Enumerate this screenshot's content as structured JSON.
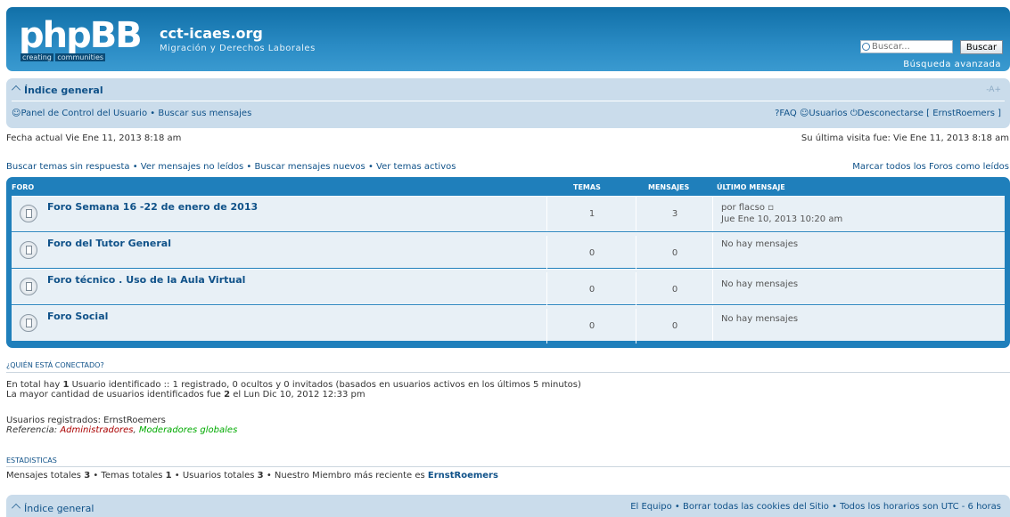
{
  "header": {
    "logo_text": "phpBB",
    "logo_tagline_a": "creating",
    "logo_tagline_b": "communities",
    "site_title": "cct-icaes.org",
    "site_description": "Migración y Derechos Laborales",
    "search_placeholder": "Buscar...",
    "search_button": "Buscar",
    "advanced_search": "Búsqueda avanzada"
  },
  "navbar": {
    "breadcrumb": "Índice general",
    "font_size_control": "-A+",
    "ucp": "Panel de Control del Usuario",
    "own_posts": "Buscar sus mensajes",
    "faq": "FAQ",
    "members": "Usuarios",
    "logout": "Desconectarse [ ErnstRoemers ]"
  },
  "dates": {
    "current": "Fecha actual Vie Ene 11, 2013 8:18 am",
    "last_visit": "Su última visita fue: Vie Ene 11, 2013 8:18 am"
  },
  "quick_links": {
    "unanswered": "Buscar temas sin respuesta",
    "unread": "Ver mensajes no leídos",
    "new_posts": "Buscar mensajes nuevos",
    "active": "Ver temas activos",
    "mark_read": "Marcar todos los Foros como leídos"
  },
  "forum_table": {
    "col_forum": "FORO",
    "col_topics": "TEMAS",
    "col_posts": "MENSAJES",
    "col_last": "ÚLTIMO MENSAJE",
    "rows": [
      {
        "title": "Foro Semana 16 -22 de enero de 2013",
        "topics": "1",
        "posts": "3",
        "last_line1": "por flacso",
        "last_line2": "Jue Ene 10, 2013 10:20 am"
      },
      {
        "title": "Foro del Tutor General",
        "topics": "0",
        "posts": "0",
        "last_line1": "No hay mensajes",
        "last_line2": ""
      },
      {
        "title": "Foro técnico . Uso de la Aula Virtual",
        "topics": "0",
        "posts": "0",
        "last_line1": "No hay mensajes",
        "last_line2": ""
      },
      {
        "title": "Foro Social",
        "topics": "0",
        "posts": "0",
        "last_line1": "No hay mensajes",
        "last_line2": ""
      }
    ]
  },
  "online": {
    "heading": "¿QUIÉN ESTÁ CONECTADO?",
    "line1_a": "En total hay ",
    "line1_count": "1",
    "line1_b": " Usuario identificado :: 1 registrado, 0 ocultos y 0 invitados (basados en usuarios activos en los últimos 5 minutos)",
    "line2_a": "La mayor cantidad de usuarios identificados fue ",
    "line2_count": "2",
    "line2_b": " el Lun Dic 10, 2012 12:33 pm",
    "registered": "Usuarios registrados: ErnstRoemers",
    "legend_label": "Referencia: ",
    "legend_admin": "Administradores",
    "legend_sep": ", ",
    "legend_gmod": "Moderadores globales"
  },
  "stats": {
    "heading": "ESTADISTICAS",
    "posts_label": "Mensajes totales ",
    "posts": "3",
    "topics_label": " • Temas totales ",
    "topics": "1",
    "users_label": " • Usuarios totales ",
    "users": "3",
    "newest_label": " • Nuestro Miembro más reciente es ",
    "newest": "ErnstRoemers"
  },
  "footer": {
    "index": "Índice general",
    "team": "El Equipo",
    "delete_cookies": "Borrar todas las cookies del Sitio",
    "timezone": "Todos los horarios son UTC - 6 horas"
  },
  "colors": {
    "header_blue": "#1170a8",
    "nav_bg": "#cadceb",
    "link": "#105289",
    "admin": "#aa0000",
    "global_mod": "#00aa00"
  }
}
